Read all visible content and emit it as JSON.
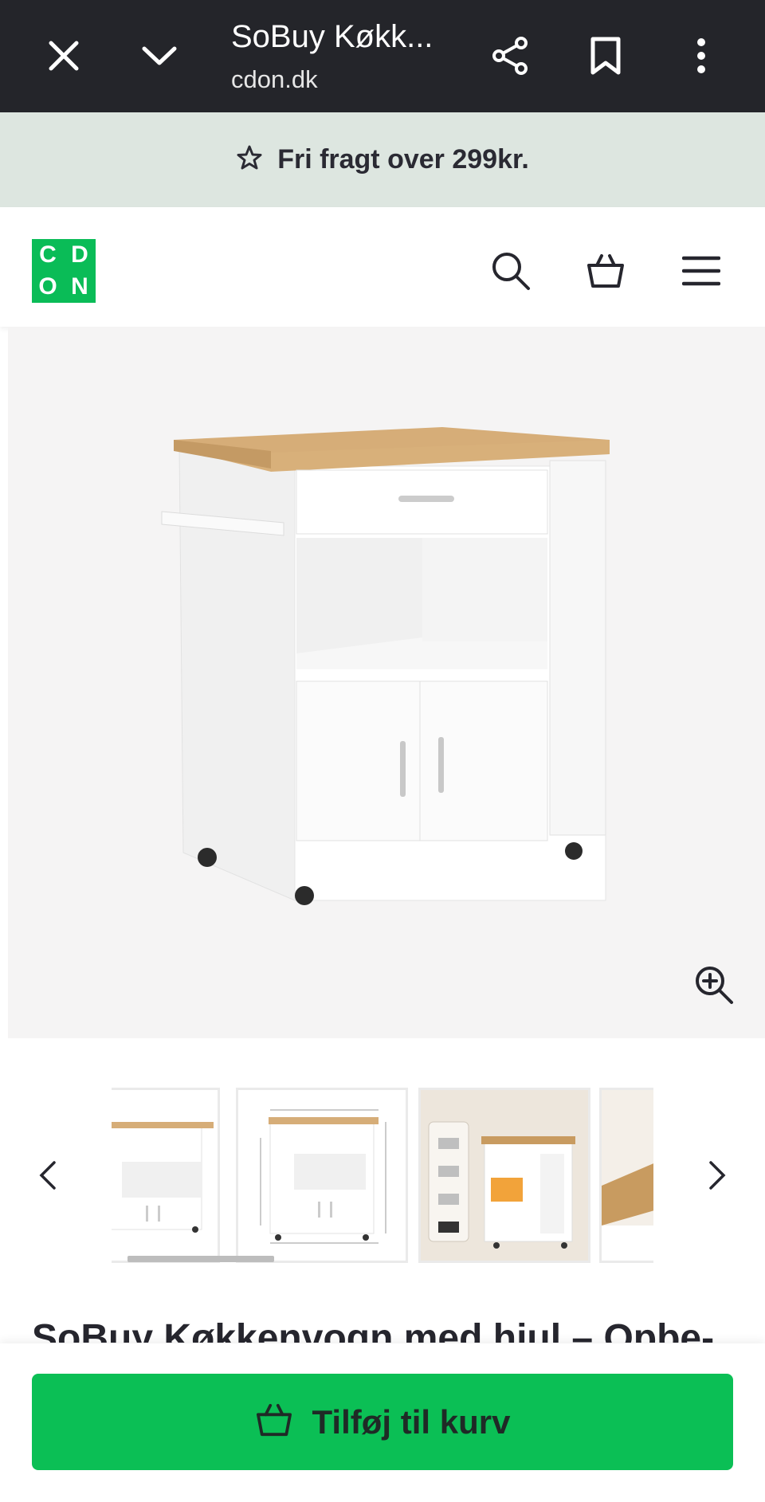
{
  "browser": {
    "title": "SoBuy Køkk...",
    "url": "cdon.dk"
  },
  "promo": {
    "text": "Fri fragt over 299kr."
  },
  "site": {
    "logo_letters": [
      "C",
      "D",
      "O",
      "N"
    ]
  },
  "product": {
    "title": "SoBuy Køkkenvogn med hjul – Opbe-"
  },
  "actions": {
    "add_to_cart": "Tilføj til kurv"
  },
  "colors": {
    "brand_green": "#0abc57",
    "topbar": "#24252a",
    "promo_bg": "#dde6e0"
  }
}
